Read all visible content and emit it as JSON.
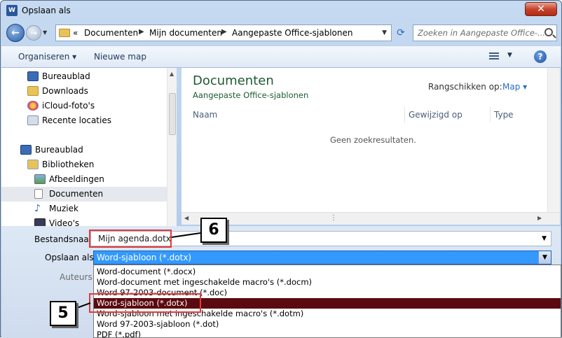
{
  "window": {
    "title": "Opslaan als",
    "app_icon": "word-icon",
    "close_glyph": "✕"
  },
  "address_bar": {
    "overflow": "«",
    "breadcrumbs": [
      "Documenten",
      "Mijn documenten",
      "Aangepaste Office-sjablonen"
    ],
    "search_placeholder": "Zoeken in Aangepaste Office-..."
  },
  "toolbar": {
    "organize_label": "Organiseren ▾",
    "new_folder_label": "Nieuwe map",
    "help_glyph": "?"
  },
  "sidebar": {
    "items": [
      {
        "label": "Bureaublad",
        "icon": "desktop-icon"
      },
      {
        "label": "Downloads",
        "icon": "downloads-folder-icon"
      },
      {
        "label": "iCloud-foto's",
        "icon": "icloud-photos-icon"
      },
      {
        "label": "Recente locaties",
        "icon": "recent-places-icon"
      },
      {
        "label": "Bureaublad",
        "icon": "desktop-icon"
      },
      {
        "label": "Bibliotheken",
        "icon": "libraries-icon"
      },
      {
        "label": "Afbeeldingen",
        "icon": "pictures-icon"
      },
      {
        "label": "Documenten",
        "icon": "documents-icon"
      },
      {
        "label": "Muziek",
        "icon": "music-icon"
      },
      {
        "label": "Video's",
        "icon": "videos-icon"
      }
    ]
  },
  "main": {
    "title": "Documenten",
    "subtitle": "Aangepaste Office-sjablonen",
    "sort_label": "Rangschikken op:",
    "sort_value": "Map",
    "columns": [
      "Naam",
      "Gewijzigd op",
      "Type"
    ],
    "empty_message": "Geen zoekresultaten."
  },
  "form": {
    "filename_label": "Bestandsnaam:",
    "filename_value": "Mijn agenda.dotx",
    "savetype_label": "Opslaan als:",
    "savetype_value": "Word-sjabloon (*.dotx)",
    "authors_label": "Auteurs:",
    "savetype_options": [
      "Word-document (*.docx)",
      "Word-document met ingeschakelde macro's (*.docm)",
      "Word 97-2003-document (*.doc)",
      "Word-sjabloon (*.dotx)",
      "Word-sjabloon met ingeschakelde macro's (*.dotm)",
      "Word 97-2003-sjabloon (*.dot)",
      "PDF (*.pdf)"
    ],
    "selected_option_index": 3
  },
  "callouts": {
    "step_filename": "6",
    "step_savetype": "5",
    "highlight_color": "#e23a3a"
  }
}
